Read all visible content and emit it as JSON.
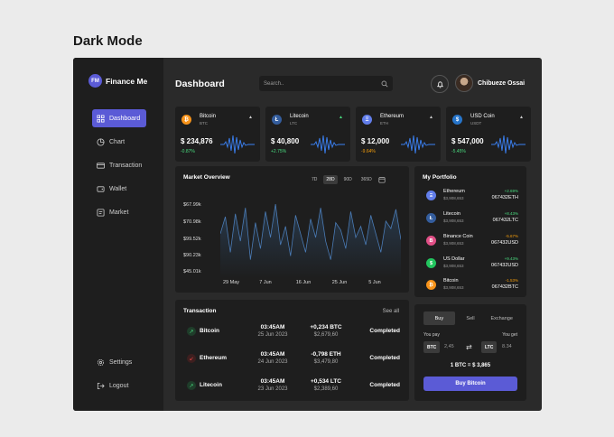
{
  "page_heading": "Dark Mode",
  "app": {
    "logo_mark": "FM",
    "name": "Finance Me",
    "nav": [
      {
        "label": "Dashboard",
        "active": true,
        "icon": "grid-icon"
      },
      {
        "label": "Chart",
        "icon": "pie-chart-icon"
      },
      {
        "label": "Transaction",
        "icon": "card-icon"
      },
      {
        "label": "Wallet",
        "icon": "wallet-icon"
      },
      {
        "label": "Market",
        "icon": "market-icon"
      }
    ],
    "nav_bottom": [
      {
        "label": "Settings",
        "icon": "gear-icon"
      },
      {
        "label": "Logout",
        "icon": "logout-icon"
      }
    ]
  },
  "header": {
    "title": "Dashboard",
    "search_placeholder": "Search..",
    "user_name": "Chibueze Ossai"
  },
  "coins": [
    {
      "name": "Bitcoin",
      "symbol": "BTC",
      "price": "$ 234,876",
      "change": "-0.87%",
      "change_color": "#4ade80",
      "icon_color": "#f7931a",
      "icon_char": "₿"
    },
    {
      "name": "Litecoin",
      "symbol": "LTC",
      "price": "$ 40,800",
      "change": "+2.75%",
      "change_color": "#4ade80",
      "icon_color": "#345d9d",
      "icon_char": "Ł"
    },
    {
      "name": "Ethereum",
      "symbol": "ETH",
      "price": "$ 12,000",
      "change": "-9.64%",
      "change_color": "#f59e0b",
      "icon_color": "#627eea",
      "icon_char": "Ξ"
    },
    {
      "name": "USD Coin",
      "symbol": "USDT",
      "price": "$ 547,000",
      "change": "-5.45%",
      "change_color": "#4ade80",
      "icon_color": "#2775ca",
      "icon_char": "$"
    }
  ],
  "market": {
    "title": "Market Overview",
    "ranges": [
      "7D",
      "28D",
      "90D",
      "365D"
    ],
    "active_range": "28D"
  },
  "chart_data": {
    "type": "line",
    "title": "Market Overview",
    "y_tick_labels": [
      "$67.99k",
      "$70.98k",
      "$99.52k",
      "$90.23k",
      "$45.01k"
    ],
    "x_tick_labels": [
      "29 May",
      "7 Jun",
      "16 Jun",
      "25 Jun",
      "5 Jun"
    ],
    "series": [
      {
        "values": [
          0.55,
          0.78,
          0.3,
          0.82,
          0.45,
          0.9,
          0.2,
          0.7,
          0.35,
          0.85,
          0.5,
          0.95,
          0.4,
          0.65,
          0.25,
          0.8,
          0.55,
          0.3,
          0.75,
          0.5,
          0.9,
          0.45,
          0.2,
          0.7,
          0.6,
          0.35,
          0.85,
          0.5,
          0.65,
          0.4,
          0.8,
          0.55,
          0.3,
          0.72,
          0.62,
          0.88,
          0.47
        ]
      }
    ],
    "grid": false
  },
  "portfolio": {
    "title": "My Portfolio",
    "items": [
      {
        "name": "Ethereum",
        "sub": "$3,908,653",
        "change": "+2.69%",
        "change_color": "#4ade80",
        "value": "067432ETH",
        "icon_color": "#627eea",
        "icon_char": "Ξ"
      },
      {
        "name": "Litecoin",
        "sub": "$3,908,653",
        "change": "+8.43%",
        "change_color": "#4ade80",
        "value": "067432LTC",
        "icon_color": "#345d9d",
        "icon_char": "Ł"
      },
      {
        "name": "Binance Coin",
        "sub": "$3,908,653",
        "change": "-5.67%",
        "change_color": "#f59e0b",
        "value": "067432USD",
        "icon_color": "#e14f86",
        "icon_char": "B"
      },
      {
        "name": "US Dollar",
        "sub": "$3,908,653",
        "change": "+9.43%",
        "change_color": "#4ade80",
        "value": "067432USD",
        "icon_color": "#22c55e",
        "icon_char": "$"
      },
      {
        "name": "Bitcoin",
        "sub": "$3,908,653",
        "change": "-1.53%",
        "change_color": "#f59e0b",
        "value": "067432BTC",
        "icon_color": "#f7931a",
        "icon_char": "₿"
      }
    ]
  },
  "transaction": {
    "title": "Transaction",
    "see_all": "See all",
    "rows": [
      {
        "name": "Bitcoin",
        "time": "03:45AM",
        "date": "25 Jun 2023",
        "amount": "+0,234 BTC",
        "usd": "$2,679,60",
        "status": "Completed",
        "dir": "up"
      },
      {
        "name": "Ethereum",
        "time": "03:45AM",
        "date": "24 Jun 2023",
        "amount": "-0,798 ETH",
        "usd": "$3,479,80",
        "status": "Completed",
        "dir": "down"
      },
      {
        "name": "Litecoin",
        "time": "03:45AM",
        "date": "23 Jun 2023",
        "amount": "+0,534 LTC",
        "usd": "$2,389,60",
        "status": "Completed",
        "dir": "up"
      }
    ]
  },
  "exchange": {
    "tabs": [
      "Buy",
      "Sell",
      "Exchange"
    ],
    "active_tab": "Buy",
    "you_pay_label": "You pay",
    "you_get_label": "You get",
    "pay_currency": "BTC",
    "pay_amount": "2,45",
    "get_currency": "LTC",
    "get_amount": "8.34",
    "rate": "1 BTC = $ 3,865",
    "button": "Buy Bitcoin"
  },
  "colors": {
    "accent": "#5b5bd6",
    "panel": "#1e1e1e",
    "bg": "#2a2a2a"
  }
}
